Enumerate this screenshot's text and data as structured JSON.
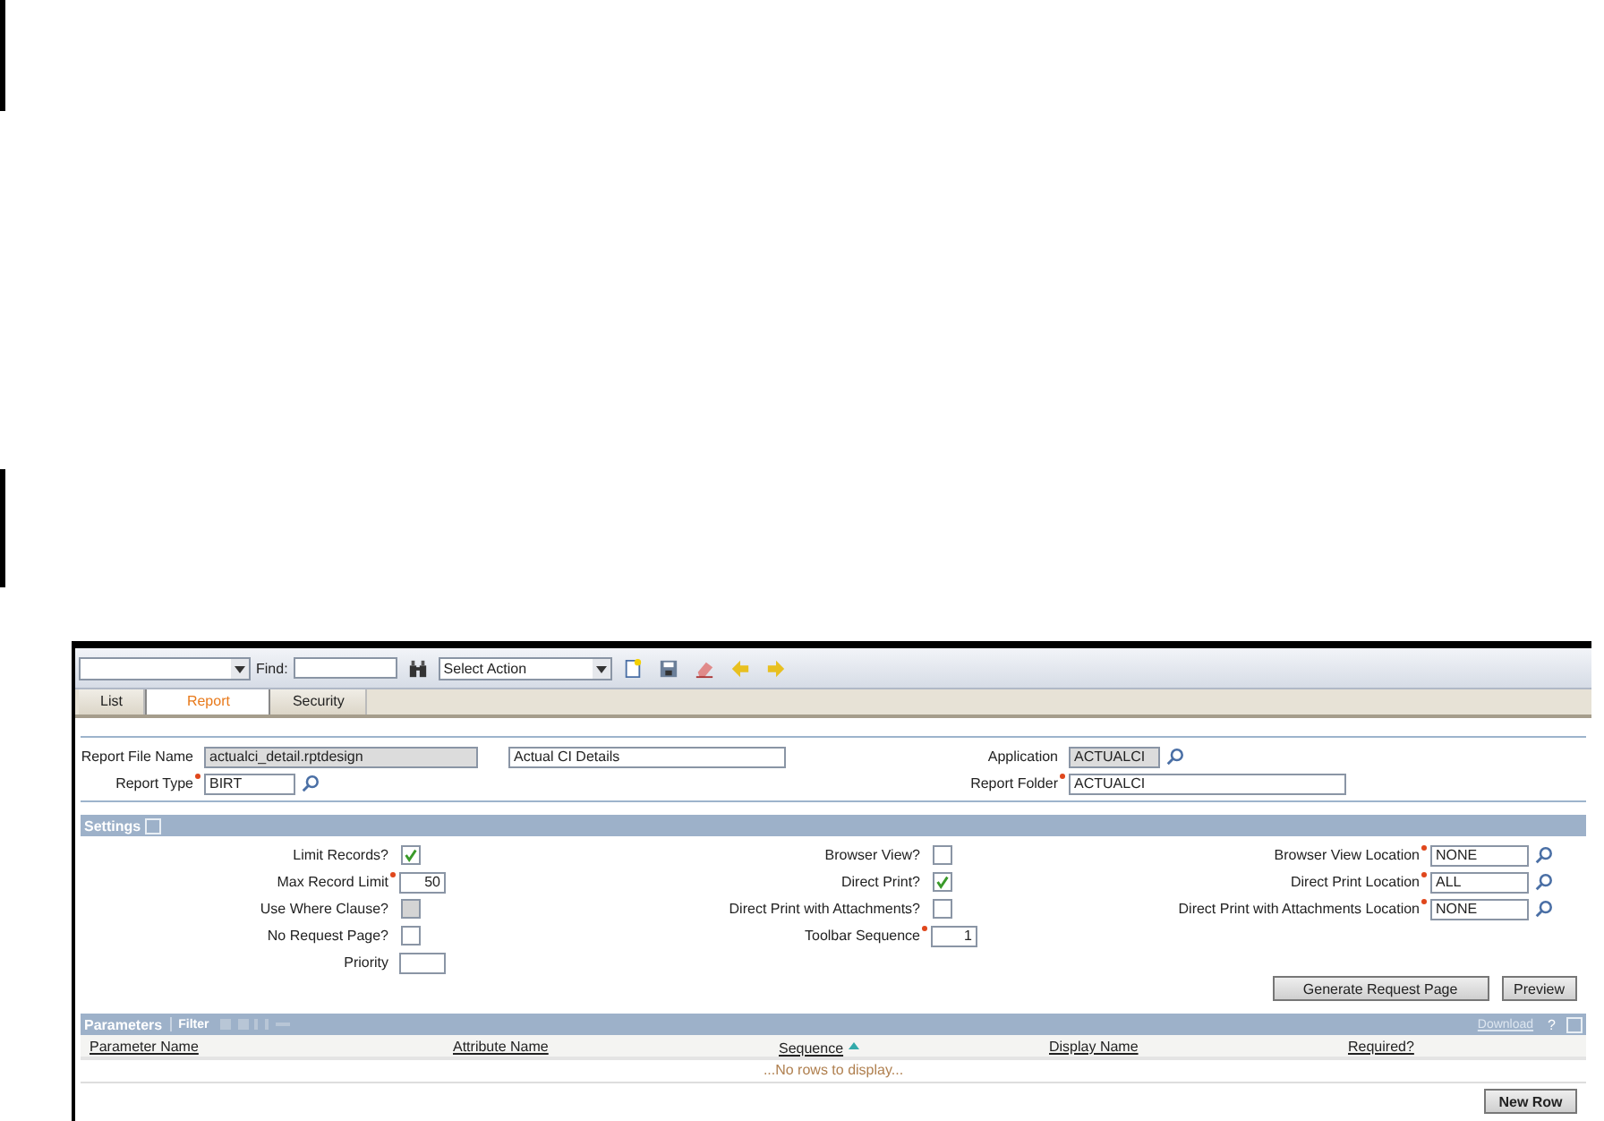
{
  "toolbar": {
    "find_label": "Find:",
    "action_select": "Select Action"
  },
  "tabs": [
    {
      "label": "List",
      "selected": false
    },
    {
      "label": "Report",
      "selected": true
    },
    {
      "label": "Security",
      "selected": false
    }
  ],
  "header_fields": {
    "left": [
      {
        "label": "Report File Name",
        "value": "actualci_detail.rptdesign",
        "required": false,
        "readonly": true,
        "lookup": false,
        "extra": "Actual CI Details"
      },
      {
        "label": "Report Type",
        "value": "BIRT",
        "required": true,
        "readonly": false,
        "lookup": true
      }
    ],
    "right": [
      {
        "label": "Application",
        "value": "ACTUALCI",
        "required": false,
        "readonly": true,
        "lookup": true
      },
      {
        "label": "Report Folder",
        "value": "ACTUALCI",
        "required": true,
        "readonly": false,
        "lookup": false
      }
    ]
  },
  "settings": {
    "title": "Settings",
    "columns": [
      [
        {
          "kind": "checkbox",
          "label": "Limit Records?",
          "checked": true,
          "disabled": false
        },
        {
          "kind": "number",
          "label": "Max Record Limit",
          "value": "50",
          "required": true
        },
        {
          "kind": "checkbox",
          "label": "Use Where Clause?",
          "checked": false,
          "disabled": true
        },
        {
          "kind": "checkbox",
          "label": "No Request Page?",
          "checked": false,
          "disabled": false
        },
        {
          "kind": "number",
          "label": "Priority",
          "required": false
        }
      ],
      [
        {
          "kind": "checkbox",
          "label": "Browser View?",
          "checked": false,
          "disabled": false
        },
        {
          "kind": "checkbox",
          "label": "Direct Print?",
          "checked": true,
          "disabled": false
        },
        {
          "kind": "checkbox",
          "label": "Direct Print with Attachments?",
          "checked": false,
          "disabled": false
        },
        {
          "kind": "number",
          "label": "Toolbar Sequence",
          "value": "1",
          "required": true
        }
      ],
      [
        {
          "kind": "lookup",
          "label": "Browser View Location",
          "value": "NONE",
          "required": true
        },
        {
          "kind": "lookup",
          "label": "Direct Print Location",
          "value": "ALL",
          "required": true
        },
        {
          "kind": "lookup",
          "label": "Direct Print with Attachments Location",
          "value": "NONE",
          "required": true
        }
      ]
    ],
    "buttons": [
      "Generate Request Page",
      "Preview"
    ]
  },
  "parameters": {
    "title": "Parameters",
    "filter": "Filter",
    "download": "Download",
    "help": "?",
    "columns": [
      {
        "label": "Parameter Name",
        "sorted": false
      },
      {
        "label": "Attribute Name",
        "sorted": false
      },
      {
        "label": "Sequence",
        "sorted": true
      },
      {
        "label": "Display Name",
        "sorted": false
      },
      {
        "label": "Required?",
        "sorted": false
      }
    ],
    "empty_message": "...No rows to display...",
    "new_row_button": "New Row"
  }
}
